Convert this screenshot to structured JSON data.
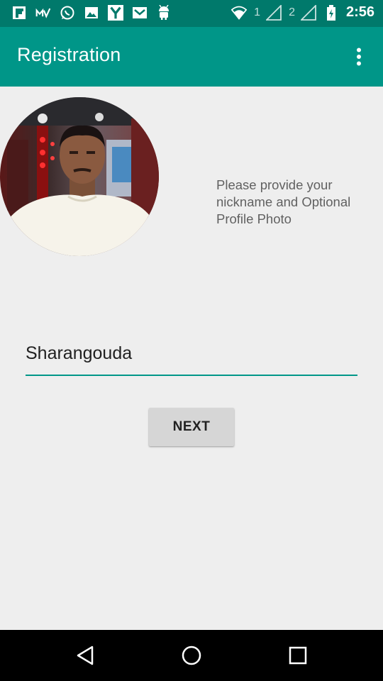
{
  "status_bar": {
    "time": "2:56",
    "sim1": "1",
    "sim2": "2",
    "left_icons": [
      "flipboard-icon",
      "mv-icon",
      "whatsapp-icon",
      "gallery-icon",
      "yahoo-icon",
      "mail-icon",
      "android-icon"
    ],
    "right_icons": [
      "wifi-icon",
      "signal-1-icon",
      "signal-2-icon",
      "battery-icon"
    ]
  },
  "app_bar": {
    "title": "Registration",
    "overflow_icon": "more-vert-icon"
  },
  "content": {
    "prompt": "Please provide your nickname and Optional Profile Photo",
    "nickname_value": "Sharangouda",
    "next_label": "NEXT",
    "avatar_icon": "profile-photo"
  },
  "nav_bar": {
    "icons": [
      "back-icon",
      "home-icon",
      "recents-icon"
    ]
  },
  "colors": {
    "status_bar": "#00796b",
    "app_bar": "#009688",
    "accent": "#009688",
    "background": "#eeeeee",
    "button": "#d6d6d6"
  }
}
